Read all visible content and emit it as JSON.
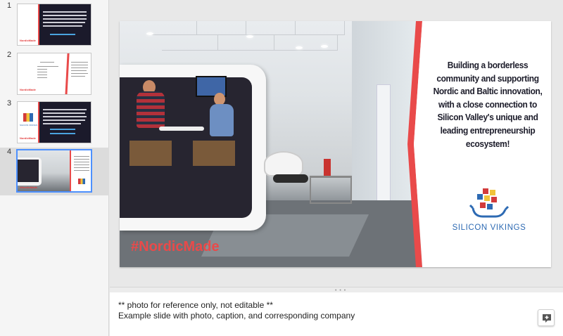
{
  "filmstrip": {
    "slides": [
      {
        "number": "1"
      },
      {
        "number": "2"
      },
      {
        "number": "3"
      },
      {
        "number": "4",
        "selected": true
      }
    ]
  },
  "slide": {
    "hashtag": "#NordicMade",
    "text_lines": [
      "Building a borderless",
      "community and supporting",
      "Nordic and Baltic innovation,",
      "with a close connection to",
      "Silicon Valley's unique and",
      "leading entrepreneurship",
      "ecosystem!"
    ],
    "company_name": "SILICON VIKINGS",
    "accent_color": "#e94a4a",
    "company_color": "#2d6ab3"
  },
  "notes": {
    "line1": "** photo for reference only, not editable **",
    "line2": "Example slide with photo, caption, and corresponding company",
    "icon": "add-comment-icon"
  }
}
